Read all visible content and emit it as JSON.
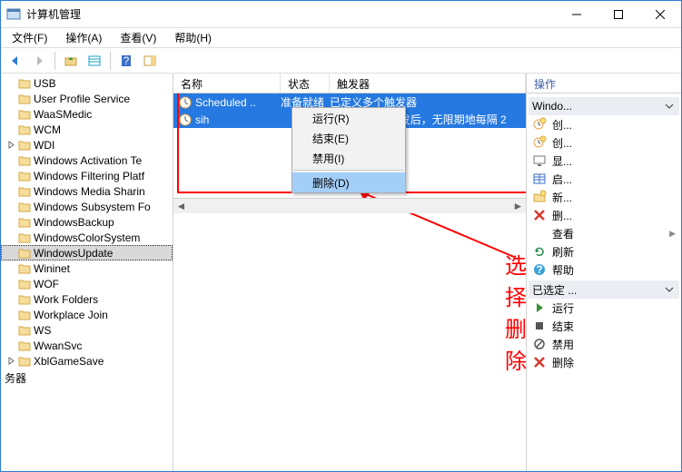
{
  "title": "计算机管理",
  "menu": {
    "file": "文件(F)",
    "action": "操作(A)",
    "view": "查看(V)",
    "help": "帮助(H)"
  },
  "tree": {
    "items": [
      {
        "label": "USB",
        "indent": 1
      },
      {
        "label": "User Profile Service",
        "indent": 1
      },
      {
        "label": "WaaSMedic",
        "indent": 1
      },
      {
        "label": "WCM",
        "indent": 1
      },
      {
        "label": "WDI",
        "indent": 1,
        "expandable": true
      },
      {
        "label": "Windows Activation Te",
        "indent": 1
      },
      {
        "label": "Windows Filtering Platf",
        "indent": 1
      },
      {
        "label": "Windows Media Sharin",
        "indent": 1
      },
      {
        "label": "Windows Subsystem Fo",
        "indent": 1
      },
      {
        "label": "WindowsBackup",
        "indent": 1
      },
      {
        "label": "WindowsColorSystem",
        "indent": 1
      },
      {
        "label": "WindowsUpdate",
        "indent": 1,
        "selected": true
      },
      {
        "label": "Wininet",
        "indent": 1
      },
      {
        "label": "WOF",
        "indent": 1
      },
      {
        "label": "Work Folders",
        "indent": 1
      },
      {
        "label": "Workplace Join",
        "indent": 1
      },
      {
        "label": "WS",
        "indent": 1
      },
      {
        "label": "WwanSvc",
        "indent": 1
      },
      {
        "label": "XblGameSave",
        "indent": 0,
        "expandable": true
      }
    ],
    "footer": "务器"
  },
  "list": {
    "columns": {
      "name": "名称",
      "status": "状态",
      "trigger": "触发器"
    },
    "rows": [
      {
        "name": "Scheduled ..",
        "status": "准备就绪",
        "trigger": "已定义多个触发器"
      },
      {
        "name": "sih",
        "status": "",
        "trigger": "的 8:00 时 - 触发后，无限期地每隔 2"
      }
    ]
  },
  "context_menu": {
    "run": "运行(R)",
    "end": "结束(E)",
    "disable": "禁用(I)",
    "delete": "删除(D)"
  },
  "annotation": {
    "text": "选择删除"
  },
  "actions": {
    "title": "操作",
    "group1": {
      "label": "Windo..."
    },
    "items1": [
      {
        "icon": "clock-new",
        "label": "创...",
        "hasMenu": false
      },
      {
        "icon": "clock-new",
        "label": "创...",
        "hasMenu": false
      },
      {
        "icon": "display",
        "label": "显...",
        "hasMenu": false
      },
      {
        "icon": "table-blue",
        "label": "启...",
        "hasMenu": false
      },
      {
        "icon": "folder-new",
        "label": "新...",
        "hasMenu": false
      },
      {
        "icon": "x-red",
        "label": "删...",
        "hasMenu": false
      },
      {
        "icon": "none",
        "label": "查看",
        "hasMenu": true
      },
      {
        "icon": "refresh",
        "label": "刷新",
        "hasMenu": false
      },
      {
        "icon": "help",
        "label": "帮助",
        "hasMenu": false
      }
    ],
    "group2": {
      "label": "已选定 ..."
    },
    "items2": [
      {
        "icon": "play",
        "label": "运行",
        "hasMenu": false
      },
      {
        "icon": "stop",
        "label": "结束",
        "hasMenu": false
      },
      {
        "icon": "disable",
        "label": "禁用",
        "hasMenu": false
      },
      {
        "icon": "x-red",
        "label": "删除",
        "hasMenu": false
      }
    ]
  }
}
